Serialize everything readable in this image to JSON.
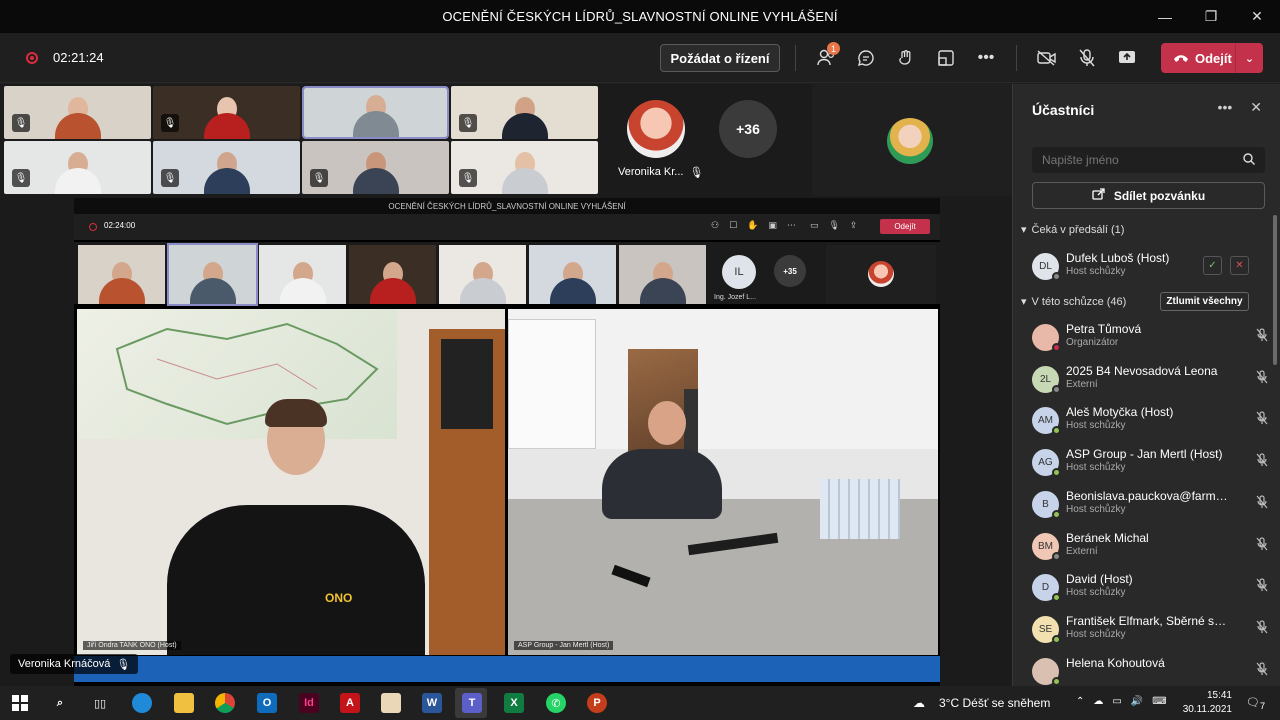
{
  "window": {
    "title": "OCENĚNÍ ČESKÝCH LÍDRŮ_SLAVNOSTNÍ ONLINE VYHLÁŠENÍ",
    "minimize": "—",
    "maximize": "❐",
    "close": "✕"
  },
  "toolbar": {
    "timer": "02:21:24",
    "request_control": "Požádat o řízení",
    "participants_badge": "1",
    "leave": "Odejít"
  },
  "stage": {
    "more_count": "+36",
    "featured_name": "Veronika Kr...",
    "speaker_label": "Veronika Krnáčová"
  },
  "shared": {
    "title": "OCENĚNÍ ČESKÝCH LÍDRŮ_SLAVNOSTNÍ ONLINE VYHLÁŠENÍ",
    "timer": "02:24:00",
    "leave": "Odejít",
    "initials_tile": "IL",
    "initials_name": "Ing. Jozef L...",
    "more_count": "+35",
    "left_label": "Jiří Ondra TANK ONO (Host)",
    "right_label": "ASP Group - Jan Mertl (Host)",
    "shirt_logo": "ONO"
  },
  "sidebar": {
    "title": "Účastníci",
    "search_placeholder": "Napište jméno",
    "invite": "Sdílet pozvánku",
    "lobby_header": "Čeká v předsálí (1)",
    "meeting_header": "V této schůzce (46)",
    "mute_all": "Ztlumit všechny",
    "lobby": [
      {
        "initials": "DL",
        "name": "Dufek Luboš (Host)",
        "role": "Host schůzky"
      }
    ],
    "participants": [
      {
        "initials": "",
        "name": "Petra Tůmová",
        "role": "Organizátor",
        "color": "#e8b8a8"
      },
      {
        "initials": "2L",
        "name": "2025 B4 Nevosadová Leona",
        "role": "Externí",
        "color": "#c7d8b5"
      },
      {
        "initials": "AM",
        "name": "Aleš Motyčka (Host)",
        "role": "Host schůzky",
        "color": "#c6d3e8"
      },
      {
        "initials": "AG",
        "name": "ASP Group - Jan Mertl (Host)",
        "role": "Host schůzky",
        "color": "#c6d3e8"
      },
      {
        "initials": "B",
        "name": "Beonislava.pauckova@farmak...",
        "role": "Host schůzky",
        "color": "#c6d3e8"
      },
      {
        "initials": "BM",
        "name": "Beránek Michal",
        "role": "Externí",
        "color": "#f0c6b4"
      },
      {
        "initials": "D",
        "name": "David (Host)",
        "role": "Host schůzky",
        "color": "#c6d3e8"
      },
      {
        "initials": "SE",
        "name": "František Elfmark, Sběrné sur...",
        "role": "Host schůzky",
        "color": "#f2e0b0"
      },
      {
        "initials": "",
        "name": "Helena Kohoutová",
        "role": "",
        "color": "#d9c0b0"
      }
    ]
  },
  "taskbar": {
    "weather": "3°C  Déšť se sněhem",
    "time": "15:41",
    "date": "30.11.2021",
    "notif_count": "7"
  }
}
